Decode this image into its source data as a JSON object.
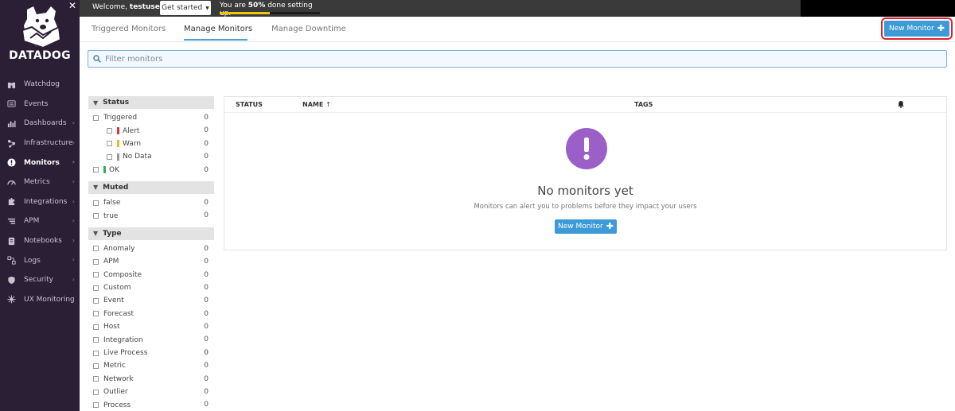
{
  "brand": {
    "name": "DATADOG"
  },
  "topbar": {
    "welcome_prefix": "Welcome, ",
    "username": "testuser!",
    "get_started_label": "Get started",
    "progress_prefix": "You are ",
    "progress_percent_label": "50%",
    "progress_suffix": " done setting up.",
    "progress_fraction": 0.5
  },
  "sidebar": {
    "items": [
      {
        "label": "Watchdog",
        "icon": "binoculars-icon",
        "has_submenu": false,
        "active": false
      },
      {
        "label": "Events",
        "icon": "list-icon",
        "has_submenu": false,
        "active": false
      },
      {
        "label": "Dashboards",
        "icon": "chart-icon",
        "has_submenu": true,
        "active": false
      },
      {
        "label": "Infrastructure",
        "icon": "nodes-icon",
        "has_submenu": true,
        "active": false
      },
      {
        "label": "Monitors",
        "icon": "alert-circle-icon",
        "has_submenu": true,
        "active": true
      },
      {
        "label": "Metrics",
        "icon": "gauge-icon",
        "has_submenu": true,
        "active": false
      },
      {
        "label": "Integrations",
        "icon": "puzzle-icon",
        "has_submenu": true,
        "active": false
      },
      {
        "label": "APM",
        "icon": "apm-icon",
        "has_submenu": true,
        "active": false
      },
      {
        "label": "Notebooks",
        "icon": "notebook-icon",
        "has_submenu": true,
        "active": false
      },
      {
        "label": "Logs",
        "icon": "logs-icon",
        "has_submenu": true,
        "active": false
      },
      {
        "label": "Security",
        "icon": "shield-icon",
        "has_submenu": true,
        "active": false
      },
      {
        "label": "UX Monitoring",
        "icon": "ux-icon",
        "has_submenu": true,
        "active": false
      }
    ]
  },
  "tabs": [
    {
      "label": "Triggered Monitors",
      "active": false
    },
    {
      "label": "Manage Monitors",
      "active": true
    },
    {
      "label": "Manage Downtime",
      "active": false
    }
  ],
  "header": {
    "new_monitor_label": "New Monitor"
  },
  "search": {
    "placeholder": "Filter monitors"
  },
  "facets": {
    "status": {
      "title": "Status",
      "rows": [
        {
          "label": "Triggered",
          "count": "0",
          "sub": false
        },
        {
          "label": "Alert",
          "count": "0",
          "sub": true,
          "color": "#e0303c"
        },
        {
          "label": "Warn",
          "count": "0",
          "sub": true,
          "color": "#f0b429"
        },
        {
          "label": "No Data",
          "count": "0",
          "sub": true,
          "color": "#999999"
        },
        {
          "label": "OK",
          "count": "0",
          "sub": false,
          "color": "#2fb15a"
        }
      ]
    },
    "muted": {
      "title": "Muted",
      "rows": [
        {
          "label": "false",
          "count": "0"
        },
        {
          "label": "true",
          "count": "0"
        }
      ]
    },
    "type": {
      "title": "Type",
      "rows": [
        {
          "label": "Anomaly",
          "count": "0"
        },
        {
          "label": "APM",
          "count": "0"
        },
        {
          "label": "Composite",
          "count": "0"
        },
        {
          "label": "Custom",
          "count": "0"
        },
        {
          "label": "Event",
          "count": "0"
        },
        {
          "label": "Forecast",
          "count": "0"
        },
        {
          "label": "Host",
          "count": "0"
        },
        {
          "label": "Integration",
          "count": "0"
        },
        {
          "label": "Live Process",
          "count": "0"
        },
        {
          "label": "Metric",
          "count": "0"
        },
        {
          "label": "Network",
          "count": "0"
        },
        {
          "label": "Outlier",
          "count": "0"
        },
        {
          "label": "Process",
          "count": "0"
        }
      ]
    }
  },
  "table": {
    "columns": {
      "status": "STATUS",
      "name": "NAME",
      "name_sort": "↑",
      "tags": "TAGS"
    },
    "empty": {
      "title": "No monitors yet",
      "subtitle": "Monitors can alert you to problems before they impact your users",
      "button_label": "New Monitor"
    }
  },
  "colors": {
    "sidebar_bg": "#2a1f35",
    "accent_blue": "#3c9ad6",
    "highlight_red": "#e0202a",
    "empty_icon_purple": "#9b5fc8"
  }
}
